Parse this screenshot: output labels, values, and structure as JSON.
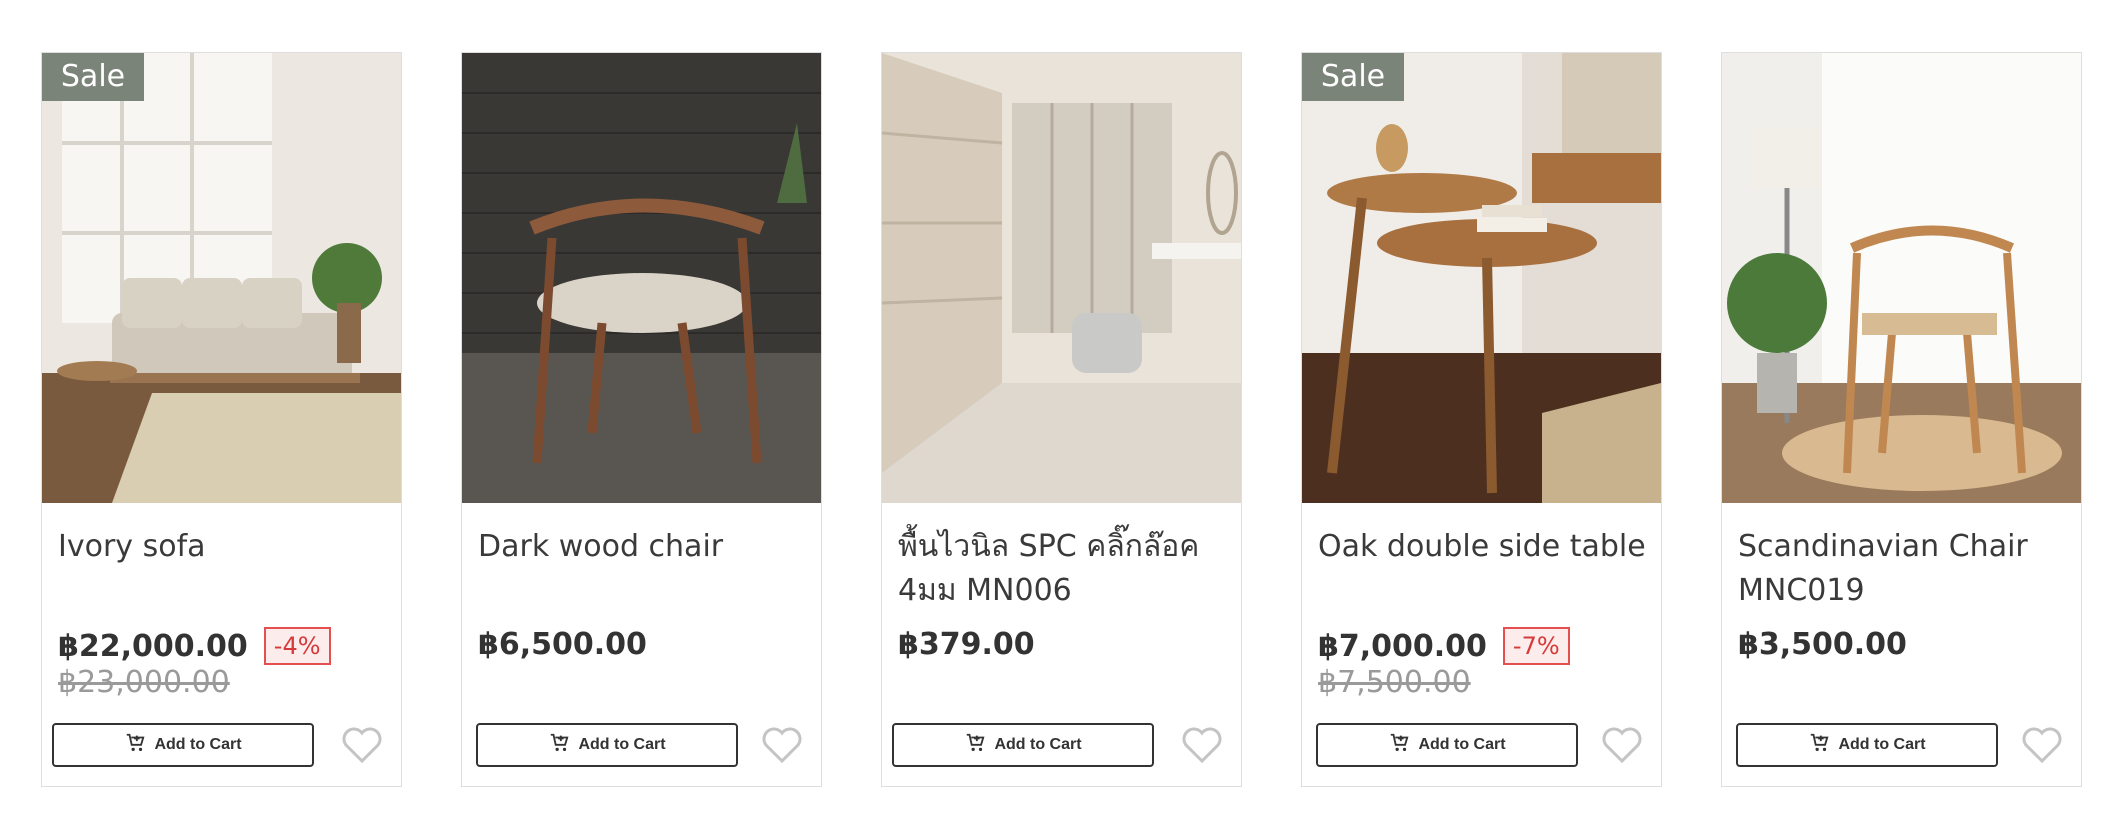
{
  "common": {
    "add_to_cart_label": "Add to Cart",
    "sale_label": "Sale",
    "icons": {
      "cart": "cart-plus-icon",
      "wishlist": "heart-outline-icon"
    },
    "colors": {
      "sale_badge_bg": "#7b8479",
      "discount_border": "#e45050",
      "discount_text": "#d63a3a",
      "text": "#3a3a3a",
      "muted": "#9a9a9a"
    }
  },
  "products": [
    {
      "title": "Ivory sofa",
      "price": "฿22,000.00",
      "discount": "-4%",
      "old_price": "฿23,000.00",
      "sale": true
    },
    {
      "title": "Dark wood chair",
      "price": "฿6,500.00",
      "sale": false
    },
    {
      "title": "พื้นไวนิล SPC คลิ๊กล๊อค 4มม MN006",
      "price": "฿379.00",
      "sale": false
    },
    {
      "title": "Oak double side table",
      "price": "฿7,000.00",
      "discount": "-7%",
      "old_price": "฿7,500.00",
      "sale": true
    },
    {
      "title": "Scandinavian Chair MNC019",
      "price": "฿3,500.00",
      "sale": false
    }
  ]
}
